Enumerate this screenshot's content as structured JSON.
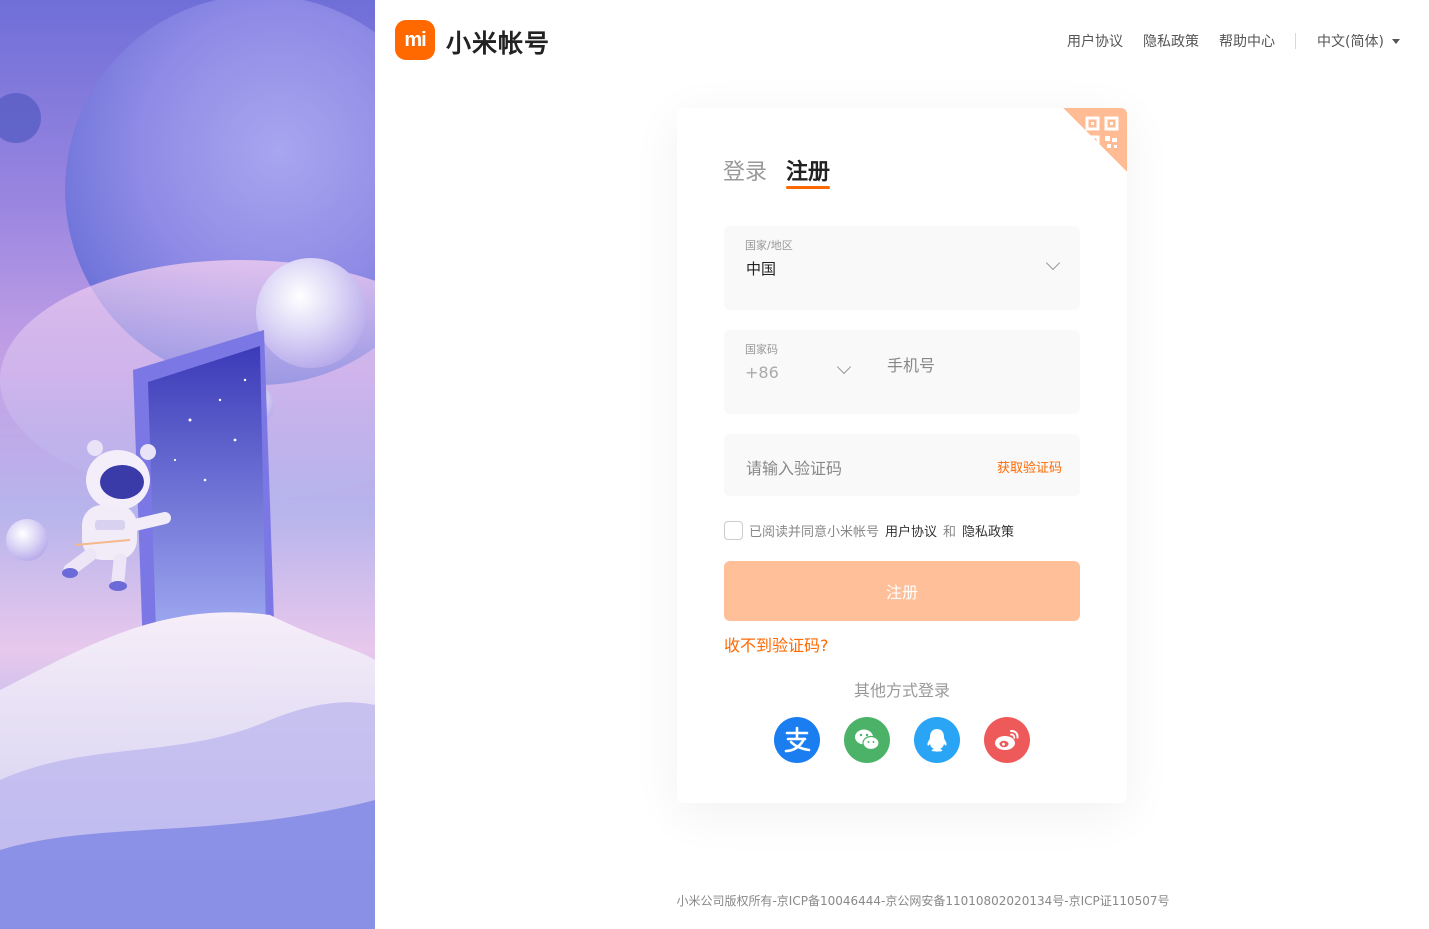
{
  "header": {
    "logo_text": "mi",
    "brand": "小米帐号",
    "nav": [
      "用户协议",
      "隐私政策",
      "帮助中心"
    ],
    "language": "中文(简体)",
    "accent": "#ff6900"
  },
  "card": {
    "tabs": {
      "login": "登录",
      "register": "注册",
      "active": "register"
    },
    "region": {
      "label": "国家/地区",
      "value": "中国"
    },
    "phone": {
      "cc_label": "国家码",
      "cc_value": "+86",
      "placeholder": "手机号"
    },
    "code": {
      "placeholder": "请输入验证码",
      "get_code": "获取验证码"
    },
    "agreement": {
      "text": "已阅读并同意小米帐号",
      "terms": "用户协议",
      "and": "和",
      "privacy": "隐私政策",
      "checked": false
    },
    "submit_label": "注册",
    "no_code": "收不到验证码?",
    "other_login": "其他方式登录",
    "social": [
      {
        "name": "alipay-icon",
        "color": "#1a7ef0"
      },
      {
        "name": "wechat-icon",
        "color": "#4cb267"
      },
      {
        "name": "qq-icon",
        "color": "#2aa4f4"
      },
      {
        "name": "weibo-icon",
        "color": "#ee5a5a"
      }
    ]
  },
  "footer": "小米公司版权所有-京ICP备10046444-京公网安备11010802020134号-京ICP证110507号"
}
